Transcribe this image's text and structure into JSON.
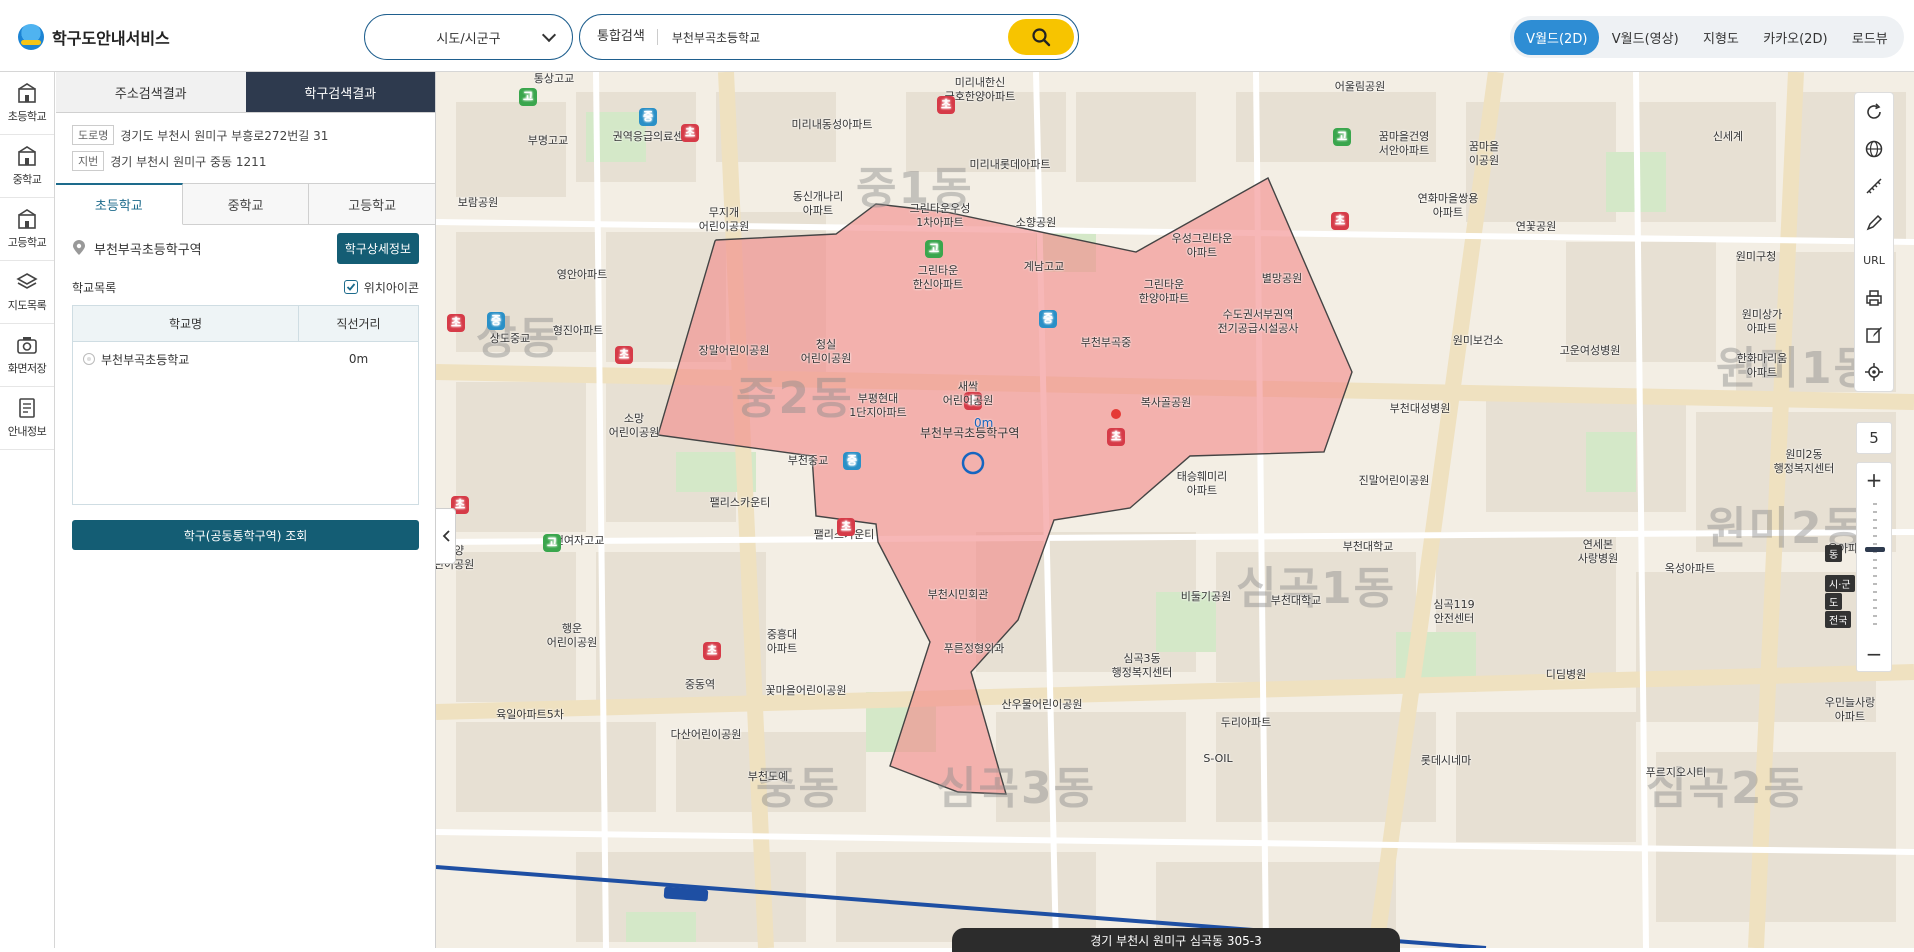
{
  "app": {
    "title": "학구도안내서비스"
  },
  "header": {
    "region_select": "시도/시군구",
    "search_type": "통합검색",
    "search_value": "부천부곡초등학교",
    "map_types": [
      "V월드(2D)",
      "V월드(영상)",
      "지형도",
      "카카오(2D)",
      "로드뷰"
    ],
    "active_map_type": "V월드(2D)"
  },
  "leftnav": {
    "items": [
      {
        "label": "초등학교",
        "icon": "elementary-school-icon"
      },
      {
        "label": "중학교",
        "icon": "middle-school-icon"
      },
      {
        "label": "고등학교",
        "icon": "high-school-icon"
      },
      {
        "label": "지도목록",
        "icon": "map-layers-icon"
      },
      {
        "label": "화면저장",
        "icon": "camera-icon"
      },
      {
        "label": "안내정보",
        "icon": "info-document-icon"
      }
    ]
  },
  "panel": {
    "tabs": [
      "주소검색결과",
      "학구검색결과"
    ],
    "active_tab": "학구검색결과",
    "road_tag": "도로명",
    "road_address": "경기도 부천시 원미구 부흥로272번길 31",
    "lot_tag": "지번",
    "lot_address": "경기 부천시 원미구 중동 1211",
    "school_tabs": [
      "초등학교",
      "중학교",
      "고등학교"
    ],
    "active_school_tab": "초등학교",
    "zone_name": "부천부곡초등학구역",
    "detail_button": "학구상세정보",
    "list_title": "학교목록",
    "location_icon_label": "위치아이콘",
    "location_icon_checked": true,
    "table": {
      "headers": [
        "학교명",
        "직선거리"
      ],
      "rows": [
        {
          "name": "부천부곡초등학교",
          "distance": "0m"
        }
      ]
    },
    "zone_query_button": "학구(공동통학구역) 조회"
  },
  "map": {
    "zone_fill_color": "#f28b8b",
    "dong_labels": [
      "중1동",
      "중2동",
      "상동",
      "심곡1동",
      "심곡3동",
      "중동",
      "원미1동",
      "원미2동",
      "심곡2동"
    ],
    "target_school_label": "부천부곡초등학구역",
    "target_distance": "0m",
    "pois": [
      {
        "name": "통상고교",
        "type": "none"
      },
      {
        "name": "미리내한신\n금호한양아파트",
        "type": "apt"
      },
      {
        "name": "어울림공원",
        "type": "park"
      },
      {
        "name": "권역응급의료센",
        "type": "none"
      },
      {
        "name": "부명고교",
        "type": "high"
      },
      {
        "name": "미리내동성아파트",
        "type": "apt"
      },
      {
        "name": "꿈마을\n이공원",
        "type": "park"
      },
      {
        "name": "꿈마을건영\n서안아파트",
        "type": "apt"
      },
      {
        "name": "신세계",
        "type": "none"
      },
      {
        "name": "미리내롯데아파트",
        "type": "apt"
      },
      {
        "name": "동신개나리\n아파트",
        "type": "apt"
      },
      {
        "name": "무지개\n어린이공원",
        "type": "park"
      },
      {
        "name": "그린타운우성\n1차아파트",
        "type": "apt"
      },
      {
        "name": "소향공원",
        "type": "park"
      },
      {
        "name": "연화마을쌍용\n아파트",
        "type": "apt"
      },
      {
        "name": "보람공원",
        "type": "park"
      },
      {
        "name": "우성그린타운\n아파트",
        "type": "apt"
      },
      {
        "name": "연꽃공원",
        "type": "park"
      },
      {
        "name": "원미구청",
        "type": "none"
      },
      {
        "name": "영안아파트",
        "type": "apt"
      },
      {
        "name": "그린타운\n한신아파트",
        "type": "apt"
      },
      {
        "name": "계남고교",
        "type": "high"
      },
      {
        "name": "그린타운\n한양아파트",
        "type": "apt"
      },
      {
        "name": "별망공원",
        "type": "park"
      },
      {
        "name": "원미상가\n아파트",
        "type": "apt"
      },
      {
        "name": "형진아파트",
        "type": "apt"
      },
      {
        "name": "상도중교",
        "type": "mid"
      },
      {
        "name": "장말어린이공원",
        "type": "park"
      },
      {
        "name": "청실\n어린이공원",
        "type": "park"
      },
      {
        "name": "부천부곡중",
        "type": "mid"
      },
      {
        "name": "수도권서부권역\n전기공급시설공사",
        "type": "none"
      },
      {
        "name": "원미보건소",
        "type": "none"
      },
      {
        "name": "고운여성병원",
        "type": "none"
      },
      {
        "name": "한화마리움\n아파트",
        "type": "apt"
      },
      {
        "name": "부평현대\n1단지아파트",
        "type": "apt"
      },
      {
        "name": "새싹\n어린이공원",
        "type": "park"
      },
      {
        "name": "복사골공원",
        "type": "park"
      },
      {
        "name": "부천대성병원",
        "type": "none"
      },
      {
        "name": "원미2동\n행정복지센터",
        "type": "none"
      },
      {
        "name": "소망\n어린이공원",
        "type": "park"
      },
      {
        "name": "부천중교",
        "type": "mid"
      },
      {
        "name": "태승훼미리\n아파트",
        "type": "apt"
      },
      {
        "name": "진말어린이공원",
        "type": "park"
      },
      {
        "name": "팰리스카운티",
        "type": "apt"
      },
      {
        "name": "팰리스카운티",
        "type": "apt"
      },
      {
        "name": "부천여자고교",
        "type": "high"
      },
      {
        "name": "태양\n린이공원",
        "type": "park"
      },
      {
        "name": "부천대학교",
        "type": "none"
      },
      {
        "name": "연세본\n사랑병원",
        "type": "none"
      },
      {
        "name": "옥성아파트",
        "type": "apt"
      },
      {
        "name": "은아파트",
        "type": "apt"
      },
      {
        "name": "부천시민회관",
        "type": "park"
      },
      {
        "name": "비둘기공원",
        "type": "park"
      },
      {
        "name": "부천대학교",
        "type": "none"
      },
      {
        "name": "심곡119\n안전센터",
        "type": "none"
      },
      {
        "name": "행운\n어린이공원",
        "type": "park"
      },
      {
        "name": "중흥대\n아파트",
        "type": "apt"
      },
      {
        "name": "푸른정형외과",
        "type": "none"
      },
      {
        "name": "심곡3동\n행정복지센터",
        "type": "none"
      },
      {
        "name": "디딤병원",
        "type": "none"
      },
      {
        "name": "중동역",
        "type": "none"
      },
      {
        "name": "꽃마을어린이공원",
        "type": "park"
      },
      {
        "name": "산우물어린이공원",
        "type": "park"
      },
      {
        "name": "우민늘사랑\n아파트",
        "type": "apt"
      },
      {
        "name": "육일아파트5차",
        "type": "apt"
      },
      {
        "name": "다산어린이공원",
        "type": "park"
      },
      {
        "name": "두리아파트",
        "type": "apt"
      },
      {
        "name": "롯데시네마",
        "type": "none"
      },
      {
        "name": "부천도예",
        "type": "none"
      },
      {
        "name": "푸르지오시티",
        "type": "apt"
      },
      {
        "name": "S-OIL",
        "type": "none"
      }
    ]
  },
  "tools": {
    "items": [
      "refresh-icon",
      "globe-icon",
      "measure-icon",
      "draw-icon",
      "URL",
      "print-icon",
      "edit-icon",
      "locate-icon"
    ],
    "url_label": "URL"
  },
  "zoom": {
    "level": "5",
    "tags": [
      "동",
      "시·군",
      "도",
      "전국"
    ],
    "plus": "+",
    "minus": "−"
  },
  "status": {
    "address": "경기 부천시 원미구 심곡동 305-3"
  }
}
